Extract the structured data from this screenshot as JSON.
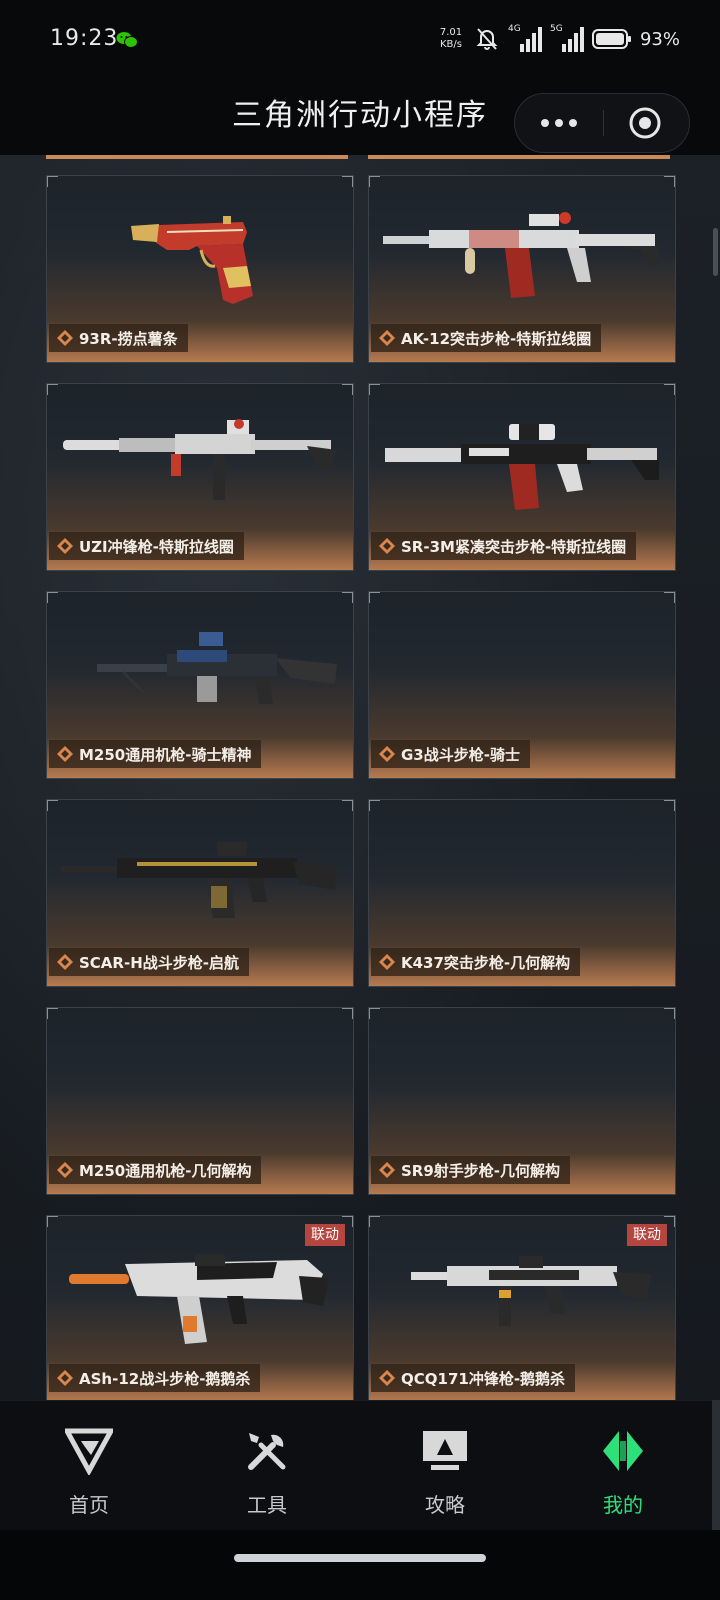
{
  "status_bar": {
    "time": "19:23",
    "net_speed_value": "7.01",
    "net_speed_unit": "KB/s",
    "signal_1_label": "4G",
    "signal_2_label": "5G",
    "battery": "93%"
  },
  "header": {
    "title": "三角洲行动小程序"
  },
  "items": [
    {
      "name": "93R-捞点薯条",
      "badge": ""
    },
    {
      "name": "AK-12突击步枪-特斯拉线圈",
      "badge": ""
    },
    {
      "name": "UZI冲锋枪-特斯拉线圈",
      "badge": ""
    },
    {
      "name": "SR-3M紧凑突击步枪-特斯拉线圈",
      "badge": ""
    },
    {
      "name": "M250通用机枪-骑士精神",
      "badge": ""
    },
    {
      "name": "G3战斗步枪-骑士",
      "badge": ""
    },
    {
      "name": "SCAR-H战斗步枪-启航",
      "badge": ""
    },
    {
      "name": "K437突击步枪-几何解构",
      "badge": ""
    },
    {
      "name": "M250通用机枪-几何解构",
      "badge": ""
    },
    {
      "name": "SR9射手步枪-几何解构",
      "badge": ""
    },
    {
      "name": "ASh-12战斗步枪-鹅鹅杀",
      "badge": "联动"
    },
    {
      "name": "QCQ171冲锋枪-鹅鹅杀",
      "badge": "联动"
    }
  ],
  "bottom_nav": [
    {
      "label": "首页",
      "icon": "home-logo-icon",
      "active": false
    },
    {
      "label": "工具",
      "icon": "tools-icon",
      "active": false
    },
    {
      "label": "攻略",
      "icon": "guide-monitor-icon",
      "active": false
    },
    {
      "label": "我的",
      "icon": "profile-logo-icon",
      "active": true
    }
  ],
  "colors": {
    "accent_active": "#2ee07a",
    "badge": "#b4453f",
    "card_bottom": "#b67a4f"
  }
}
